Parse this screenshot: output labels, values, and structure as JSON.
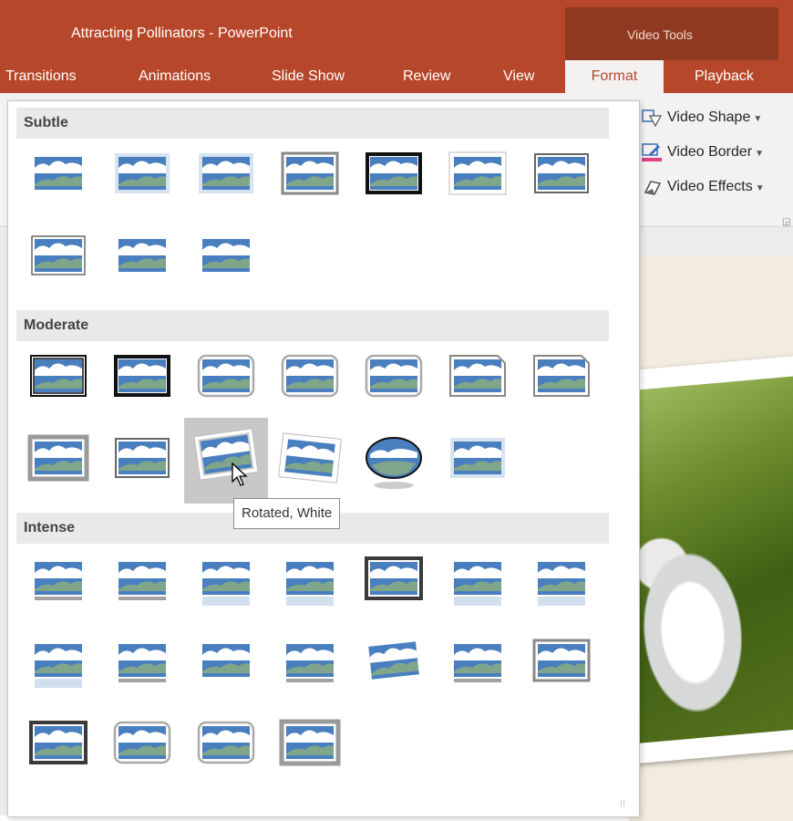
{
  "window": {
    "doc_title": "Attracting Pollinators - PowerPoint",
    "context_title": "Video Tools"
  },
  "tabs": [
    {
      "label": "Transitions",
      "active": false
    },
    {
      "label": "Animations",
      "active": false
    },
    {
      "label": "Slide Show",
      "active": false
    },
    {
      "label": "Review",
      "active": false
    },
    {
      "label": "View",
      "active": false
    },
    {
      "label": "Format",
      "active": true
    },
    {
      "label": "Playback",
      "active": false
    }
  ],
  "ribbon": {
    "video_shape": "Video Shape",
    "video_border": "Video Border",
    "video_effects": "Video Effects"
  },
  "gallery": {
    "sections": {
      "subtle": "Subtle",
      "moderate": "Moderate",
      "intense": "Intense"
    },
    "tooltip": "Rotated, White",
    "hovered_style": "Rotated, White",
    "counts": {
      "subtle": 10,
      "moderate": 13,
      "intense": 18
    }
  },
  "colors": {
    "accent": "#b7472a",
    "context": "#8f3a20",
    "sky": "#4a7fbf",
    "hill": "#7fa68b",
    "border_pink": "#e04080"
  }
}
